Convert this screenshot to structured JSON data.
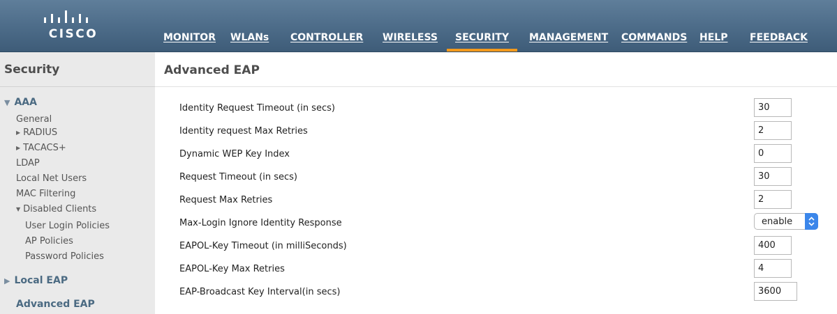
{
  "brand": {
    "name": "CISCO"
  },
  "nav": {
    "items": [
      {
        "label": "MONITOR"
      },
      {
        "label": "WLANs"
      },
      {
        "label": "CONTROLLER"
      },
      {
        "label": "WIRELESS"
      },
      {
        "label": "SECURITY",
        "active": true
      },
      {
        "label": "MANAGEMENT"
      },
      {
        "label": "COMMANDS"
      },
      {
        "label": "HELP"
      },
      {
        "label": "FEEDBACK"
      }
    ],
    "active_color": "#f39a1d"
  },
  "sidebar": {
    "title": "Security",
    "aaa": {
      "label": "AAA",
      "items": [
        {
          "label": "General"
        },
        {
          "label": "RADIUS"
        },
        {
          "label": "TACACS+"
        },
        {
          "label": "LDAP"
        },
        {
          "label": "Local Net Users"
        },
        {
          "label": "MAC Filtering"
        },
        {
          "label": "Disabled Clients"
        },
        {
          "label": "User Login Policies"
        },
        {
          "label": "AP Policies"
        },
        {
          "label": "Password Policies"
        }
      ]
    },
    "local_eap": {
      "label": "Local EAP"
    },
    "advanced_eap": {
      "label": "Advanced EAP"
    }
  },
  "main": {
    "title": "Advanced EAP",
    "rows": [
      {
        "label": "Identity Request Timeout (in secs)",
        "value": "30"
      },
      {
        "label": "Identity request Max Retries",
        "value": "2"
      },
      {
        "label": "Dynamic WEP Key Index",
        "value": "0"
      },
      {
        "label": "Request Timeout (in secs)",
        "value": "30"
      },
      {
        "label": "Request Max Retries",
        "value": "2"
      },
      {
        "label": "Max-Login Ignore Identity Response",
        "value": "enable"
      },
      {
        "label": "EAPOL-Key Timeout (in milliSeconds)",
        "value": "400"
      },
      {
        "label": "EAPOL-Key Max Retries",
        "value": "4"
      },
      {
        "label": "EAP-Broadcast Key Interval(in secs)",
        "value": "3600"
      }
    ]
  }
}
